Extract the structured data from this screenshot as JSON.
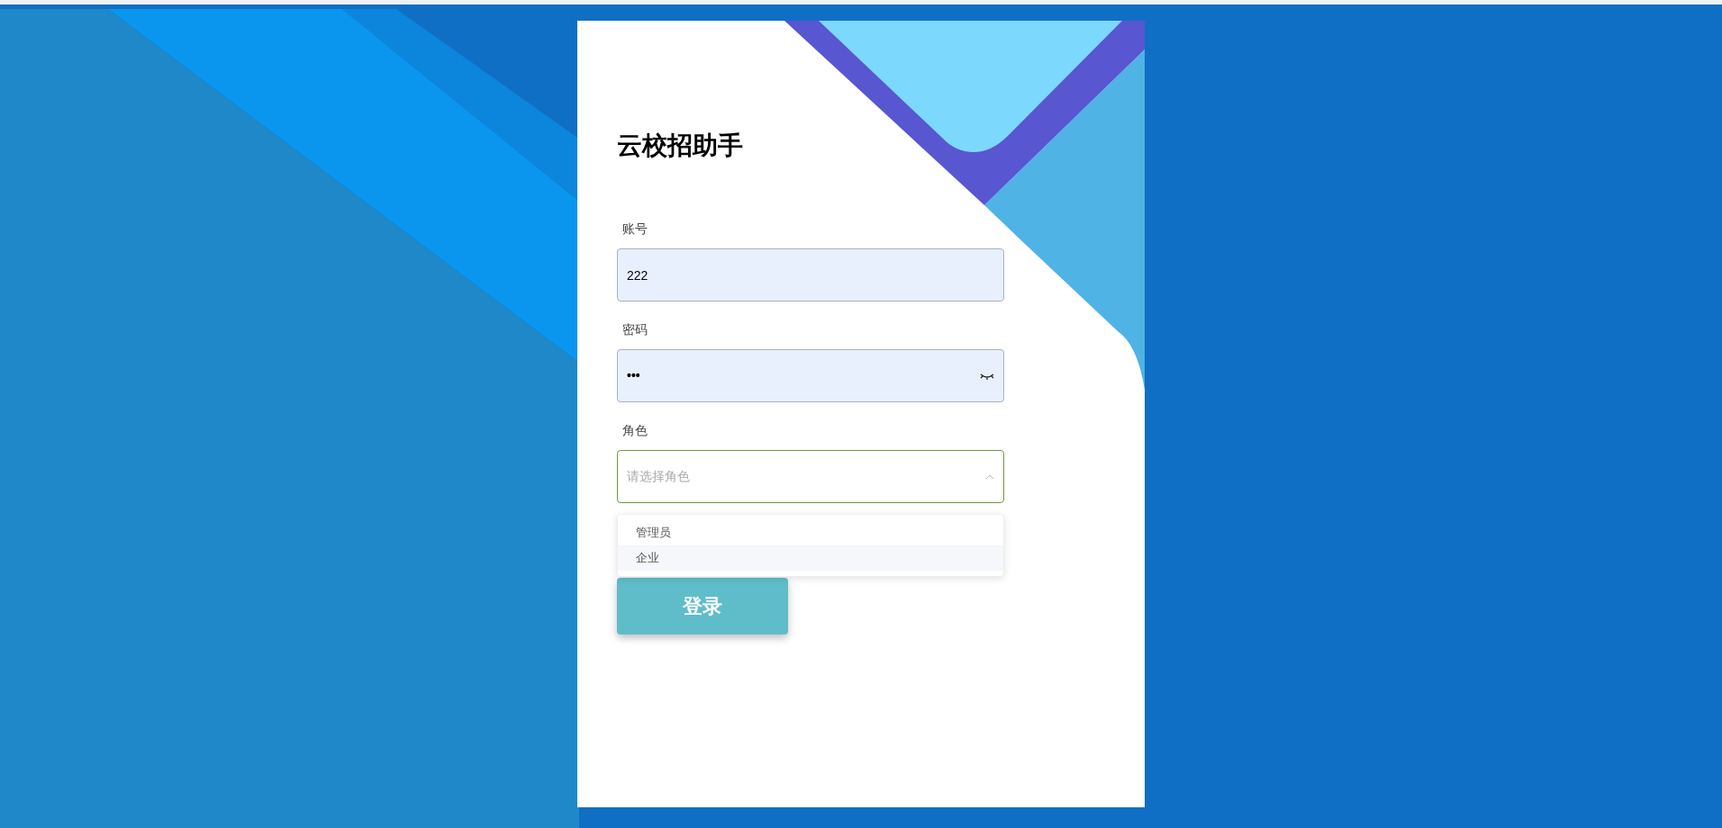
{
  "title": "云校招助手",
  "account": {
    "label": "账号",
    "value": "222"
  },
  "password": {
    "label": "密码",
    "value": "•••"
  },
  "role": {
    "label": "角色",
    "placeholder": "请选择角色",
    "expanded": true,
    "options": [
      {
        "label": "管理员",
        "highlighted": false
      },
      {
        "label": "企业",
        "highlighted": true
      }
    ]
  },
  "login_button": "登录"
}
